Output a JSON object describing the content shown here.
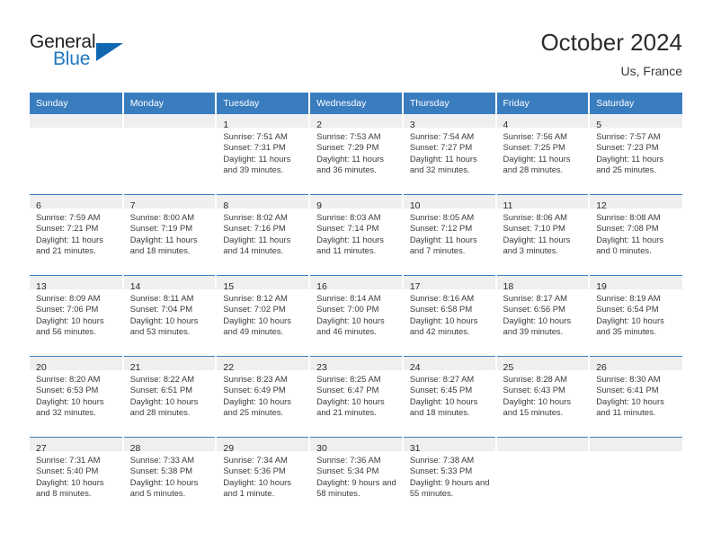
{
  "brand": {
    "name_top": "General",
    "name_bottom": "Blue",
    "triangle_color": "#1068b0",
    "blue_color": "#2077c0"
  },
  "header": {
    "title": "October 2024",
    "subtitle": "Us, France"
  },
  "theme": {
    "header_blue": "#3a7dbf",
    "daynum_band": "#efefef",
    "text": "#3b3b3b"
  },
  "weekdays": [
    "Sunday",
    "Monday",
    "Tuesday",
    "Wednesday",
    "Thursday",
    "Friday",
    "Saturday"
  ],
  "labels": {
    "sunrise": "Sunrise:",
    "sunset": "Sunset:",
    "daylight": "Daylight:"
  },
  "weeks": [
    [
      {
        "day": "",
        "sunrise": "",
        "sunset": "",
        "daylight": "",
        "empty": true
      },
      {
        "day": "",
        "sunrise": "",
        "sunset": "",
        "daylight": "",
        "empty": true
      },
      {
        "day": "1",
        "sunrise": "Sunrise: 7:51 AM",
        "sunset": "Sunset: 7:31 PM",
        "daylight": "Daylight: 11 hours and 39 minutes."
      },
      {
        "day": "2",
        "sunrise": "Sunrise: 7:53 AM",
        "sunset": "Sunset: 7:29 PM",
        "daylight": "Daylight: 11 hours and 36 minutes."
      },
      {
        "day": "3",
        "sunrise": "Sunrise: 7:54 AM",
        "sunset": "Sunset: 7:27 PM",
        "daylight": "Daylight: 11 hours and 32 minutes."
      },
      {
        "day": "4",
        "sunrise": "Sunrise: 7:56 AM",
        "sunset": "Sunset: 7:25 PM",
        "daylight": "Daylight: 11 hours and 28 minutes."
      },
      {
        "day": "5",
        "sunrise": "Sunrise: 7:57 AM",
        "sunset": "Sunset: 7:23 PM",
        "daylight": "Daylight: 11 hours and 25 minutes."
      }
    ],
    [
      {
        "day": "6",
        "sunrise": "Sunrise: 7:59 AM",
        "sunset": "Sunset: 7:21 PM",
        "daylight": "Daylight: 11 hours and 21 minutes."
      },
      {
        "day": "7",
        "sunrise": "Sunrise: 8:00 AM",
        "sunset": "Sunset: 7:19 PM",
        "daylight": "Daylight: 11 hours and 18 minutes."
      },
      {
        "day": "8",
        "sunrise": "Sunrise: 8:02 AM",
        "sunset": "Sunset: 7:16 PM",
        "daylight": "Daylight: 11 hours and 14 minutes."
      },
      {
        "day": "9",
        "sunrise": "Sunrise: 8:03 AM",
        "sunset": "Sunset: 7:14 PM",
        "daylight": "Daylight: 11 hours and 11 minutes."
      },
      {
        "day": "10",
        "sunrise": "Sunrise: 8:05 AM",
        "sunset": "Sunset: 7:12 PM",
        "daylight": "Daylight: 11 hours and 7 minutes."
      },
      {
        "day": "11",
        "sunrise": "Sunrise: 8:06 AM",
        "sunset": "Sunset: 7:10 PM",
        "daylight": "Daylight: 11 hours and 3 minutes."
      },
      {
        "day": "12",
        "sunrise": "Sunrise: 8:08 AM",
        "sunset": "Sunset: 7:08 PM",
        "daylight": "Daylight: 11 hours and 0 minutes."
      }
    ],
    [
      {
        "day": "13",
        "sunrise": "Sunrise: 8:09 AM",
        "sunset": "Sunset: 7:06 PM",
        "daylight": "Daylight: 10 hours and 56 minutes."
      },
      {
        "day": "14",
        "sunrise": "Sunrise: 8:11 AM",
        "sunset": "Sunset: 7:04 PM",
        "daylight": "Daylight: 10 hours and 53 minutes."
      },
      {
        "day": "15",
        "sunrise": "Sunrise: 8:12 AM",
        "sunset": "Sunset: 7:02 PM",
        "daylight": "Daylight: 10 hours and 49 minutes."
      },
      {
        "day": "16",
        "sunrise": "Sunrise: 8:14 AM",
        "sunset": "Sunset: 7:00 PM",
        "daylight": "Daylight: 10 hours and 46 minutes."
      },
      {
        "day": "17",
        "sunrise": "Sunrise: 8:16 AM",
        "sunset": "Sunset: 6:58 PM",
        "daylight": "Daylight: 10 hours and 42 minutes."
      },
      {
        "day": "18",
        "sunrise": "Sunrise: 8:17 AM",
        "sunset": "Sunset: 6:56 PM",
        "daylight": "Daylight: 10 hours and 39 minutes."
      },
      {
        "day": "19",
        "sunrise": "Sunrise: 8:19 AM",
        "sunset": "Sunset: 6:54 PM",
        "daylight": "Daylight: 10 hours and 35 minutes."
      }
    ],
    [
      {
        "day": "20",
        "sunrise": "Sunrise: 8:20 AM",
        "sunset": "Sunset: 6:53 PM",
        "daylight": "Daylight: 10 hours and 32 minutes."
      },
      {
        "day": "21",
        "sunrise": "Sunrise: 8:22 AM",
        "sunset": "Sunset: 6:51 PM",
        "daylight": "Daylight: 10 hours and 28 minutes."
      },
      {
        "day": "22",
        "sunrise": "Sunrise: 8:23 AM",
        "sunset": "Sunset: 6:49 PM",
        "daylight": "Daylight: 10 hours and 25 minutes."
      },
      {
        "day": "23",
        "sunrise": "Sunrise: 8:25 AM",
        "sunset": "Sunset: 6:47 PM",
        "daylight": "Daylight: 10 hours and 21 minutes."
      },
      {
        "day": "24",
        "sunrise": "Sunrise: 8:27 AM",
        "sunset": "Sunset: 6:45 PM",
        "daylight": "Daylight: 10 hours and 18 minutes."
      },
      {
        "day": "25",
        "sunrise": "Sunrise: 8:28 AM",
        "sunset": "Sunset: 6:43 PM",
        "daylight": "Daylight: 10 hours and 15 minutes."
      },
      {
        "day": "26",
        "sunrise": "Sunrise: 8:30 AM",
        "sunset": "Sunset: 6:41 PM",
        "daylight": "Daylight: 10 hours and 11 minutes."
      }
    ],
    [
      {
        "day": "27",
        "sunrise": "Sunrise: 7:31 AM",
        "sunset": "Sunset: 5:40 PM",
        "daylight": "Daylight: 10 hours and 8 minutes."
      },
      {
        "day": "28",
        "sunrise": "Sunrise: 7:33 AM",
        "sunset": "Sunset: 5:38 PM",
        "daylight": "Daylight: 10 hours and 5 minutes."
      },
      {
        "day": "29",
        "sunrise": "Sunrise: 7:34 AM",
        "sunset": "Sunset: 5:36 PM",
        "daylight": "Daylight: 10 hours and 1 minute."
      },
      {
        "day": "30",
        "sunrise": "Sunrise: 7:36 AM",
        "sunset": "Sunset: 5:34 PM",
        "daylight": "Daylight: 9 hours and 58 minutes."
      },
      {
        "day": "31",
        "sunrise": "Sunrise: 7:38 AM",
        "sunset": "Sunset: 5:33 PM",
        "daylight": "Daylight: 9 hours and 55 minutes."
      },
      {
        "day": "",
        "sunrise": "",
        "sunset": "",
        "daylight": "",
        "empty": true
      },
      {
        "day": "",
        "sunrise": "",
        "sunset": "",
        "daylight": "",
        "empty": true
      }
    ]
  ]
}
